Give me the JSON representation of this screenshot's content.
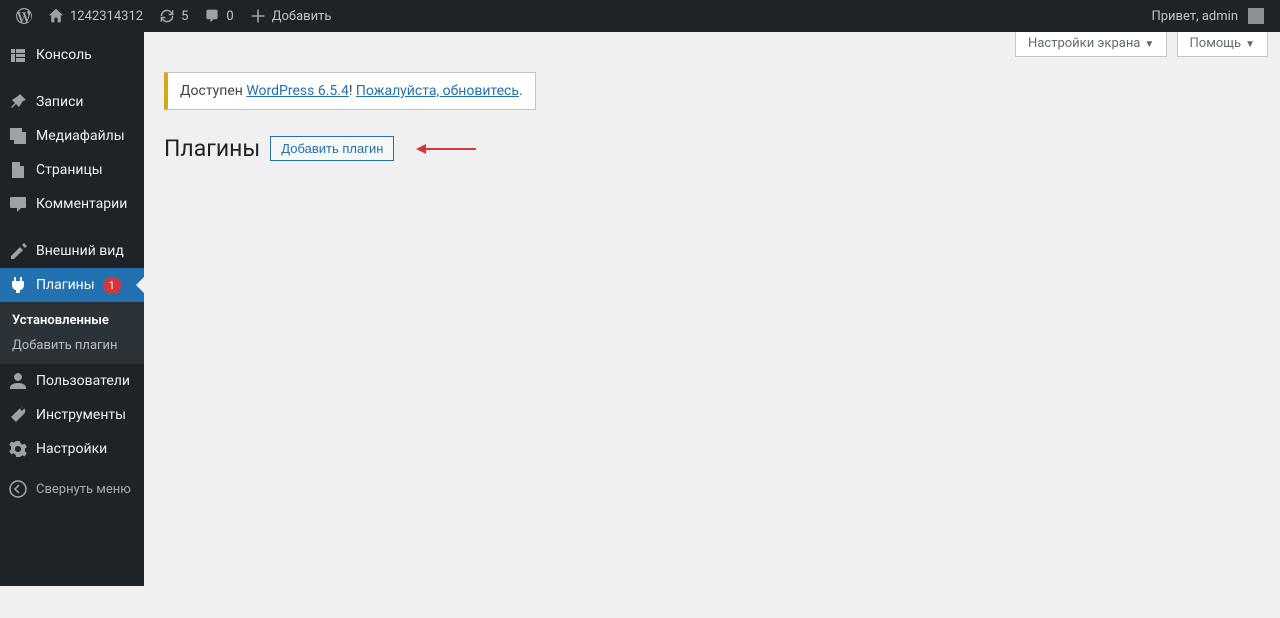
{
  "adminbar": {
    "site_name": "1242314312",
    "updates_count": "5",
    "comments_count": "0",
    "new_label": "Добавить",
    "greeting": "Привет, admin"
  },
  "sidebar": {
    "items": [
      {
        "label": "Консоль"
      },
      {
        "label": "Записи"
      },
      {
        "label": "Медиафайлы"
      },
      {
        "label": "Страницы"
      },
      {
        "label": "Комментарии"
      },
      {
        "label": "Внешний вид"
      },
      {
        "label": "Плагины",
        "badge": "1"
      },
      {
        "label": "Пользователи"
      },
      {
        "label": "Инструменты"
      },
      {
        "label": "Настройки"
      }
    ],
    "submenu_plugins": [
      {
        "label": "Установленные"
      },
      {
        "label": "Добавить плагин"
      }
    ],
    "collapse_label": "Свернуть меню"
  },
  "screen_links": {
    "options": "Настройки экрана",
    "help": "Помощь"
  },
  "notice": {
    "prefix": "Доступен ",
    "version_link": "WordPress 6.5.4",
    "sep": "! ",
    "update_link": "Пожалуйста, обновитесь",
    "suffix": "."
  },
  "header": {
    "title": "Плагины",
    "add_button": "Добавить плагин"
  }
}
